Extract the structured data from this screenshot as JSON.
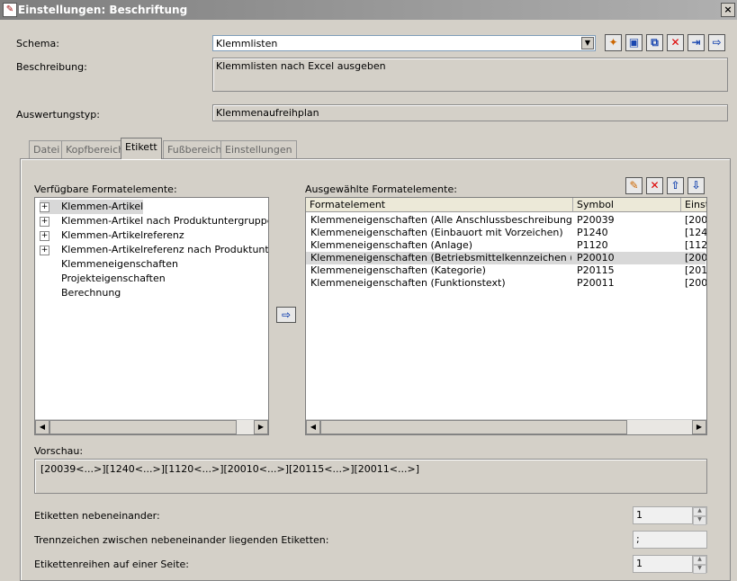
{
  "window": {
    "title": "Einstellungen: Beschriftung",
    "close": "×"
  },
  "schema": {
    "label": "Schema:",
    "value": "Klemmlisten"
  },
  "beschreibung": {
    "label": "Beschreibung:",
    "value": "Klemmlisten nach Excel ausgeben"
  },
  "auswertungstyp": {
    "label": "Auswertungstyp:",
    "value": "Klemmenaufreihplan"
  },
  "tabs": [
    {
      "label": "Datei"
    },
    {
      "label": "Kopfbereich"
    },
    {
      "label": "Etikett"
    },
    {
      "label": "Fußbereich"
    },
    {
      "label": "Einstellungen"
    }
  ],
  "active_tab": "Etikett",
  "available": {
    "label": "Verfügbare Formatelemente:",
    "items": [
      {
        "label": "Klemmen-Artikel",
        "expandable": true,
        "selected": true
      },
      {
        "label": "Klemmen-Artikel nach Produktuntergruppen",
        "expandable": true
      },
      {
        "label": "Klemmen-Artikelreferenz",
        "expandable": true
      },
      {
        "label": "Klemmen-Artikelreferenz nach Produktuntergrup",
        "expandable": true
      },
      {
        "label": "Klemmeneigenschaften",
        "expandable": false
      },
      {
        "label": "Projekteigenschaften",
        "expandable": false
      },
      {
        "label": "Berechnung",
        "expandable": false
      }
    ]
  },
  "selected": {
    "label": "Ausgewählte Formatelemente:",
    "columns": [
      "Formatelement",
      "Symbol",
      "Einst"
    ],
    "rows": [
      {
        "element": "Klemmeneigenschaften (Alle Anschlussbeschreibungen)",
        "symbol": "P20039",
        "einst": "[200"
      },
      {
        "element": "Klemmeneigenschaften (Einbauort mit Vorzeichen)",
        "symbol": "P1240",
        "einst": "[124"
      },
      {
        "element": "Klemmeneigenschaften (Anlage)",
        "symbol": "P1120",
        "einst": "[112"
      },
      {
        "element": "Klemmeneigenschaften (Betriebsmittelkennzeichen (sichtb…",
        "symbol": "P20010",
        "einst": "[200"
      },
      {
        "element": "Klemmeneigenschaften (Kategorie)",
        "symbol": "P20115",
        "einst": "[201"
      },
      {
        "element": "Klemmeneigenschaften (Funktionstext)",
        "symbol": "P20011",
        "einst": "[200"
      }
    ],
    "selected_row": 3
  },
  "transfer_icon": "arrow-right-icon",
  "vorschau": {
    "label": "Vorschau:",
    "value": "[20039<...>][1240<...>][1120<...>][20010<...>][20115<...>][20011<...>]"
  },
  "etiketten_nebeneinander": {
    "label": "Etiketten nebeneinander:",
    "value": "1"
  },
  "trennzeichen": {
    "label": "Trennzeichen zwischen nebeneinander liegenden Etiketten:",
    "value": ";"
  },
  "etikettenreihen": {
    "label": "Etikettenreihen auf einer Seite:",
    "value": "1"
  }
}
